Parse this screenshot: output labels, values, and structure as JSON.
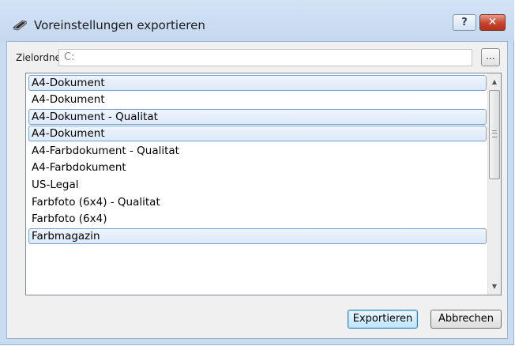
{
  "window": {
    "title": "Voreinstellungen exportieren",
    "help_label": "?",
    "close_label": "✕"
  },
  "folder": {
    "label": "Zielordner",
    "value": "C:",
    "browse_label": "..."
  },
  "presets": [
    {
      "label": "A4-Dokument",
      "selected": true
    },
    {
      "label": "A4-Dokument",
      "selected": false
    },
    {
      "label": "A4-Dokument - Qualitat",
      "selected": true
    },
    {
      "label": "A4-Dokument",
      "selected": true
    },
    {
      "label": "A4-Farbdokument - Qualitat",
      "selected": false
    },
    {
      "label": "A4-Farbdokument",
      "selected": false
    },
    {
      "label": "US-Legal",
      "selected": false
    },
    {
      "label": "Farbfoto (6x4) - Qualitat",
      "selected": false
    },
    {
      "label": "Farbfoto (6x4)",
      "selected": false
    },
    {
      "label": "Farbmagazin",
      "selected": true
    }
  ],
  "buttons": {
    "export_label": "Exportieren",
    "cancel_label": "Abbrechen"
  }
}
